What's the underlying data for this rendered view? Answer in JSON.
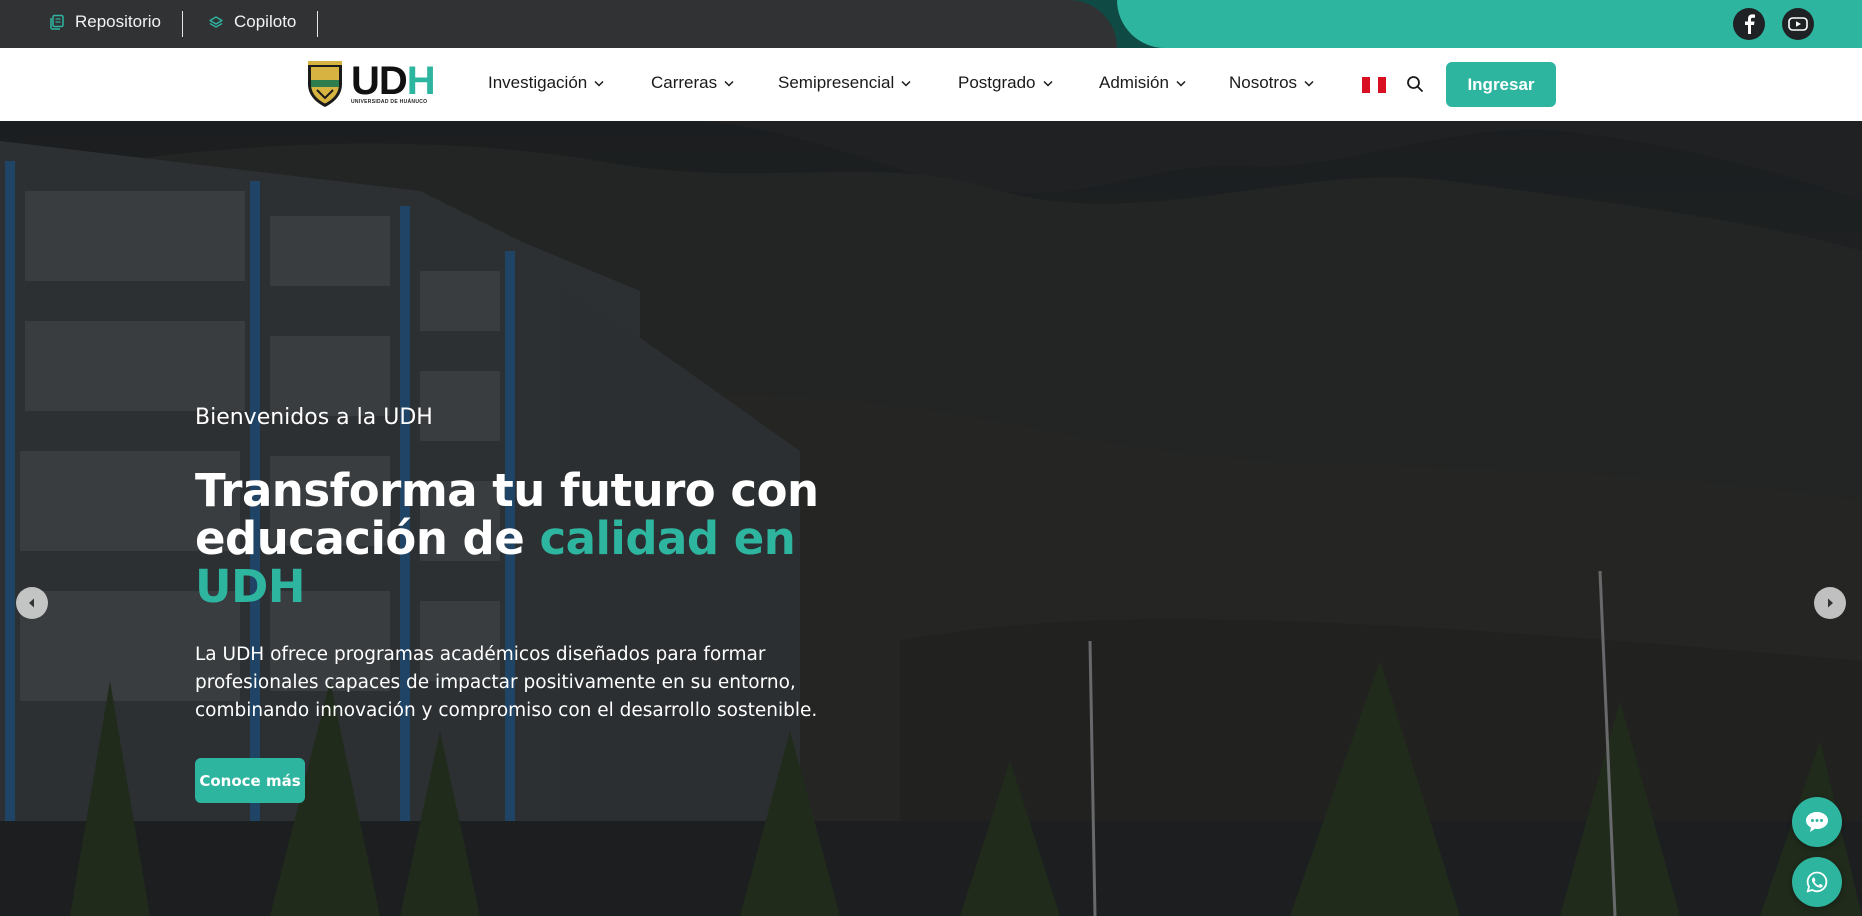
{
  "topbar": {
    "links": [
      {
        "label": "Repositorio",
        "icon": "book-stack-icon"
      },
      {
        "label": "Copiloto",
        "icon": "layers-icon"
      }
    ],
    "social": [
      {
        "icon": "facebook-icon"
      },
      {
        "icon": "youtube-icon"
      }
    ],
    "colors": {
      "dark": "#303234",
      "accent": "#2eb5a0"
    }
  },
  "nav": {
    "logo": {
      "main": "UDH",
      "sub": "UNIVERSIDAD DE HUÁNUCO"
    },
    "items": [
      {
        "label": "Investigación"
      },
      {
        "label": "Carreras"
      },
      {
        "label": "Semipresencial"
      },
      {
        "label": "Postgrado"
      },
      {
        "label": "Admisión"
      },
      {
        "label": "Nosotros"
      }
    ],
    "flag": "peru-flag-icon",
    "search_icon": "search-icon",
    "login_label": "Ingresar"
  },
  "hero": {
    "kicker": "Bienvenidos a la UDH",
    "title_part1": "Transforma tu futuro con educación de ",
    "title_accent": "calidad en UDH",
    "description": "La UDH ofrece programas académicos diseñados para formar profesionales capaces de impactar positivamente en su entorno, combinando innovación y compromiso con el desarrollo sostenible.",
    "cta_label": "Conoce más",
    "prev_icon": "chevron-left-icon",
    "next_icon": "chevron-right-icon"
  },
  "floating": {
    "chat_icon": "chat-bubble-icon",
    "whatsapp_icon": "whatsapp-icon"
  }
}
